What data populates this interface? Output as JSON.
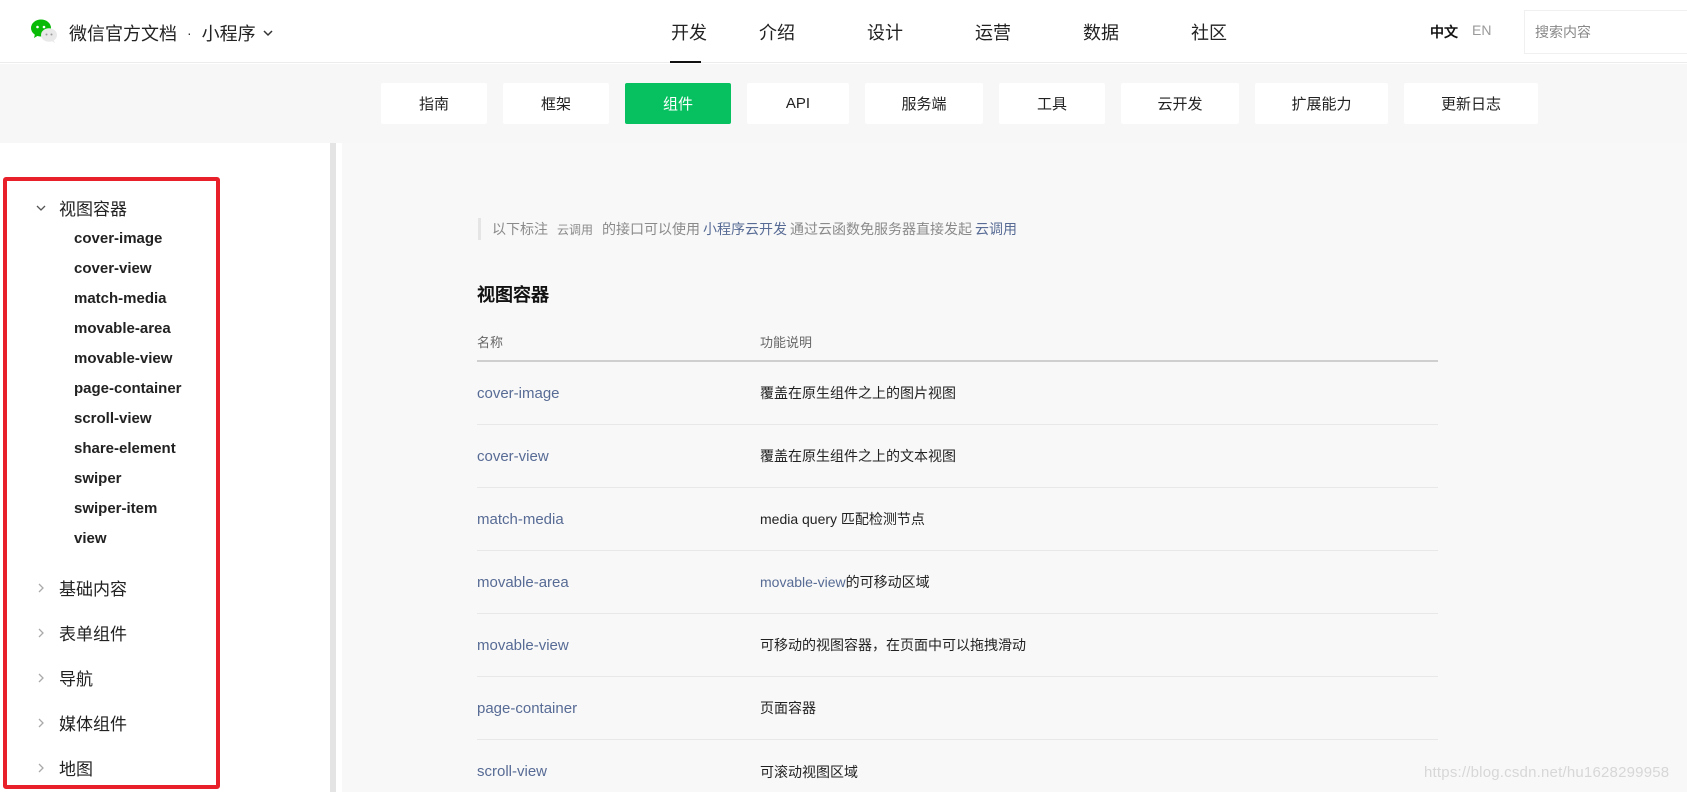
{
  "header": {
    "brand": "微信官方文档",
    "separator": "·",
    "product": "小程序",
    "nav": [
      "开发",
      "介绍",
      "设计",
      "运营",
      "数据",
      "社区"
    ],
    "active_nav": "开发",
    "lang_zh": "中文",
    "lang_en": "EN",
    "search_placeholder": "搜索内容"
  },
  "subnav": {
    "tabs": [
      "指南",
      "框架",
      "组件",
      "API",
      "服务端",
      "工具",
      "云开发",
      "扩展能力",
      "更新日志"
    ],
    "active": "组件"
  },
  "sidebar": {
    "open_group": "视图容器",
    "items": [
      "cover-image",
      "cover-view",
      "match-media",
      "movable-area",
      "movable-view",
      "page-container",
      "scroll-view",
      "share-element",
      "swiper",
      "swiper-item",
      "view"
    ],
    "groups": [
      "基础内容",
      "表单组件",
      "导航",
      "媒体组件",
      "地图"
    ]
  },
  "content": {
    "note_prefix": "以下标注",
    "note_tag": "云调用",
    "note_mid": "的接口可以使用",
    "note_link1": "小程序云开发",
    "note_mid2": "通过云函数免服务器直接发起",
    "note_link2": "云调用",
    "section_title": "视图容器",
    "col_name": "名称",
    "col_desc": "功能说明",
    "rows": [
      {
        "name": "cover-image",
        "desc": "覆盖在原生组件之上的图片视图"
      },
      {
        "name": "cover-view",
        "desc": "覆盖在原生组件之上的文本视图"
      },
      {
        "name": "match-media",
        "desc": "media query 匹配检测节点"
      },
      {
        "name": "movable-area",
        "desc_link": "movable-view",
        "desc": "的可移动区域"
      },
      {
        "name": "movable-view",
        "desc": "可移动的视图容器，在页面中可以拖拽滑动"
      },
      {
        "name": "page-container",
        "desc": "页面容器"
      },
      {
        "name": "scroll-view",
        "desc": "可滚动视图区域"
      }
    ]
  },
  "watermark": "https://blog.csdn.net/hu1628299958",
  "colors": {
    "accent": "#07c160",
    "link": "#576b95",
    "highlight_border": "#e8202a"
  }
}
